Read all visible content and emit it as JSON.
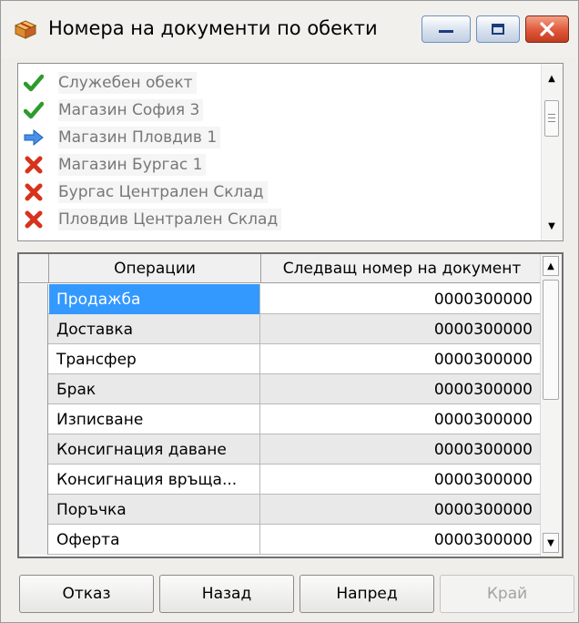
{
  "window": {
    "title": "Номера на документи по обекти",
    "icon": "package-icon"
  },
  "objects": [
    {
      "label": "Служебен обект",
      "status": "check",
      "icon": "check-icon",
      "color": "#2e9b2e"
    },
    {
      "label": "Магазин София 3",
      "status": "check",
      "icon": "check-icon",
      "color": "#2e9b2e"
    },
    {
      "label": "Магазин Пловдив 1",
      "status": "current",
      "icon": "arrow-right-icon",
      "color": "#2f7fe0"
    },
    {
      "label": "Магазин Бургас 1",
      "status": "cross",
      "icon": "cross-icon",
      "color": "#d8321c"
    },
    {
      "label": "Бургас Централен Склад",
      "status": "cross",
      "icon": "cross-icon",
      "color": "#d8321c"
    },
    {
      "label": "Пловдив Централен Склад",
      "status": "cross",
      "icon": "cross-icon",
      "color": "#d8321c"
    }
  ],
  "grid": {
    "columns": [
      "Операции",
      "Следващ номер на документ"
    ],
    "rows": [
      {
        "operation": "Продажба",
        "number": "0000300000",
        "selected": true
      },
      {
        "operation": "Доставка",
        "number": "0000300000"
      },
      {
        "operation": "Трансфер",
        "number": "0000300000"
      },
      {
        "operation": "Брак",
        "number": "0000300000"
      },
      {
        "operation": "Изписване",
        "number": "0000300000"
      },
      {
        "operation": "Консигнация даване",
        "number": "0000300000"
      },
      {
        "operation": "Консигнация връща...",
        "number": "0000300000"
      },
      {
        "operation": "Поръчка",
        "number": "0000300000"
      },
      {
        "operation": "Оферта",
        "number": "0000300000"
      }
    ]
  },
  "buttons": {
    "cancel": "Отказ",
    "back": "Назад",
    "next": "Напред",
    "finish": "Край"
  },
  "colors": {
    "selection": "#3399ff",
    "alt_row": "#e9e9e9"
  }
}
